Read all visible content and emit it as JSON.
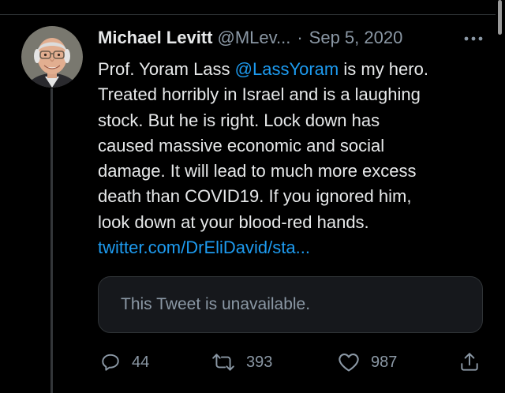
{
  "tweet": {
    "author": {
      "display_name": "Michael Levitt",
      "handle": "@MLev...",
      "separator": "·",
      "date": "Sep 5, 2020"
    },
    "body": {
      "line1_prefix": "Prof. Yoram Lass ",
      "line1_mention": "@LassYoram",
      "line1_suffix": " is my hero.",
      "line2": "Treated horribly in Israel and is a laughing",
      "line3": "stock.  But he is right. Lock down has",
      "line4": "caused massive economic and social",
      "line5": "damage. It will lead to much more excess",
      "line6": "death than COVID19. If you ignored him,",
      "line7": "look down at your blood-red hands.",
      "link": "twitter.com/DrEliDavid/sta..."
    },
    "quoted": {
      "text": "This Tweet is unavailable."
    },
    "actions": {
      "reply_count": "44",
      "retweet_count": "393",
      "like_count": "987"
    }
  },
  "colors": {
    "background": "#000000",
    "text_primary": "#e7e9ea",
    "text_secondary": "#8b98a5",
    "link": "#1d9bf0",
    "border": "#2f3336",
    "card_background": "#16181c"
  },
  "icons": {
    "more": "more-dots-icon",
    "reply": "reply-icon",
    "retweet": "retweet-icon",
    "like": "heart-icon",
    "share": "share-icon"
  }
}
